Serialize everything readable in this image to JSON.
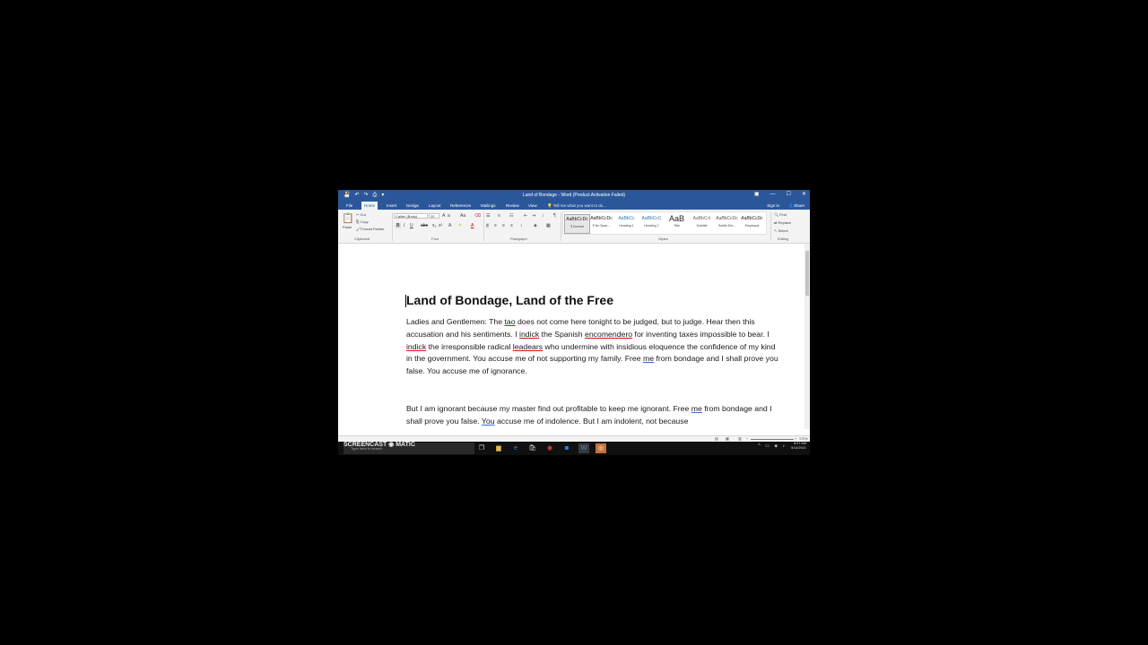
{
  "app": {
    "title": "Land of Bondage - Word (Product Activation Failed)",
    "qat": [
      "💾",
      "↶",
      "↷",
      "⎙",
      "▾"
    ],
    "window_controls": [
      "▣",
      "—",
      "☐",
      "✕"
    ]
  },
  "tabs": {
    "items": [
      "File",
      "Home",
      "Insert",
      "Design",
      "Layout",
      "References",
      "Mailings",
      "Review",
      "View"
    ],
    "tell_me": "Tell me what you want to do...",
    "sign_in": "Sign in",
    "share": "Share"
  },
  "ribbon": {
    "clipboard": {
      "paste": "Paste",
      "cut": "Cut",
      "copy": "Copy",
      "format_painter": "Format Painter",
      "label": "Clipboard"
    },
    "font": {
      "name": "Calibri (Body)",
      "size": "20",
      "label": "Font"
    },
    "paragraph": {
      "label": "Paragraph"
    },
    "styles": {
      "label": "Styles",
      "items": [
        {
          "preview": "AaBbCcDc",
          "name": "¶ Normal"
        },
        {
          "preview": "AaBbCcDc",
          "name": "¶ No Spac..."
        },
        {
          "preview": "AaBbCc",
          "name": "Heading 1"
        },
        {
          "preview": "AaBbCcC",
          "name": "Heading 2"
        },
        {
          "preview": "AaB",
          "name": "Title"
        },
        {
          "preview": "AaBbCcI",
          "name": "Subtitle"
        },
        {
          "preview": "AaBbCcDc",
          "name": "Subtle Em..."
        },
        {
          "preview": "AaBbCcDc",
          "name": "Emphasis"
        }
      ]
    },
    "editing": {
      "find": "Find",
      "replace": "Replace",
      "select": "Select",
      "label": "Editing"
    }
  },
  "document": {
    "title": "Land of Bondage, Land of the Free",
    "p1": {
      "s1": "Ladies and Gentlemen: The ",
      "w_tao": "tao",
      "s2": " does not come here tonight to be judged, but to judge. Hear then this accusation and his sentiments. I ",
      "w_indick1": "indick",
      "s3": " the Spanish ",
      "w_encomendero": "encomendero",
      "s4": " for inventing taxes impossible to bear. I ",
      "w_indick2": "indick",
      "s5": " the irresponsible radical ",
      "w_leadears": "leadears",
      "s6": " who undermine with insidious eloquence the confidence of my kind in the government. You accuse me of not supporting my family. Free ",
      "w_me1": "me",
      "s7": " from bondage and I shall prove you false. You accuse me of ignorance."
    },
    "p2": {
      "s1": "But I am ignorant because my master find out profitable to keep me ignorant. Free ",
      "w_me": "me",
      "s2": " from bondage and I shall prove you false. ",
      "w_you": "You",
      "s3": " accuse me of indolence. But I am indolent, not because"
    }
  },
  "status": {
    "zoom": "170%"
  },
  "taskbar": {
    "watermark": "SCREENCAST ◉ MATIC",
    "search_placeholder": "Type here to search",
    "time": "8:47 AM",
    "date": "5/14/2021"
  }
}
